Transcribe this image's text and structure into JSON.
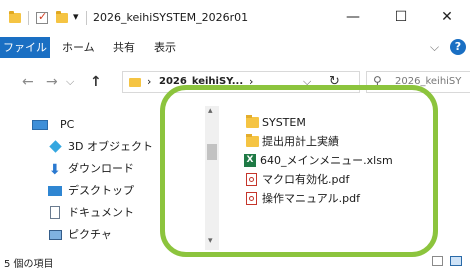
{
  "window": {
    "title": "2026_keihiSYSTEM_2026r01",
    "minimize_glyph": "—",
    "maximize_glyph": "☐",
    "close_glyph": "✕",
    "quick_access_dropdown": "▾"
  },
  "ribbon": {
    "tabs": [
      "ファイル",
      "ホーム",
      "共有",
      "表示"
    ],
    "expand_glyph": "⌵",
    "help_glyph": "?"
  },
  "address": {
    "back_glyph": "←",
    "forward_glyph": "→",
    "history_glyph": "⌵",
    "up_glyph": "↑",
    "sep_glyph": "›",
    "crumb": "2026_keihiSY...",
    "dropdown_glyph": "⌵",
    "refresh_glyph": "↻",
    "search_glyph": "⚲",
    "search_placeholder": "2026_keihiSY"
  },
  "sidebar": {
    "items": [
      {
        "label": "PC",
        "icon": "pc-icon"
      },
      {
        "label": "3D オブジェクト",
        "icon": "3d-objects-icon"
      },
      {
        "label": "ダウンロード",
        "icon": "download-icon"
      },
      {
        "label": "デスクトップ",
        "icon": "desktop-icon"
      },
      {
        "label": "ドキュメント",
        "icon": "documents-icon"
      },
      {
        "label": "ピクチャ",
        "icon": "pictures-icon"
      }
    ]
  },
  "files": [
    {
      "name": "SYSTEM",
      "type": "folder"
    },
    {
      "name": "提出用計上実績",
      "type": "folder"
    },
    {
      "name": "640_メインメニュー.xlsm",
      "type": "excel"
    },
    {
      "name": "マクロ有効化.pdf",
      "type": "pdf"
    },
    {
      "name": "操作マニュアル.pdf",
      "type": "pdf"
    }
  ],
  "status": {
    "item_count": "5 個の項目"
  },
  "colors": {
    "accent": "#1a6fc3",
    "annotation": "#8cc43d",
    "folder": "#f5c443",
    "pdf": "#c5352b",
    "excel": "#1f7a45"
  }
}
